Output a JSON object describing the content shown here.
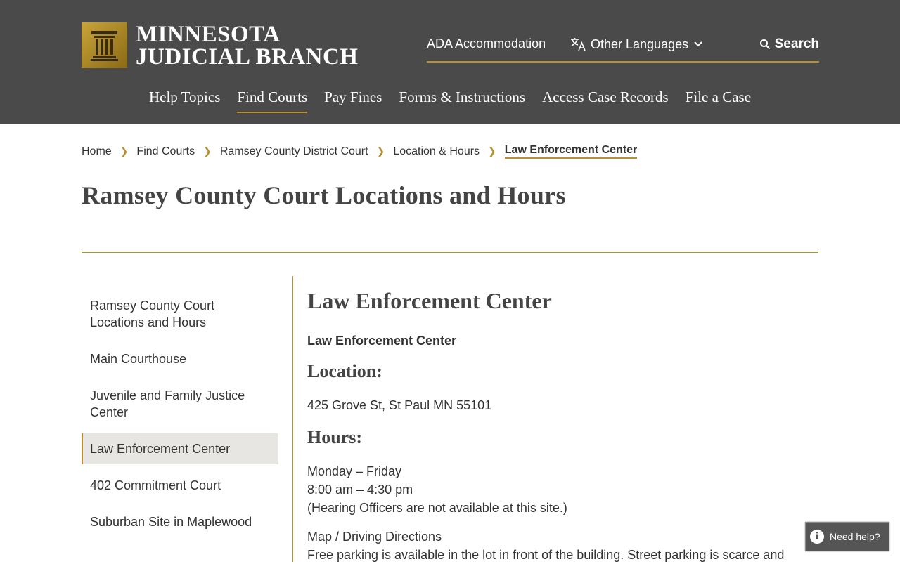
{
  "header": {
    "logo_line1": "MINNESOTA",
    "logo_line2": "JUDICIAL BRANCH",
    "utility": {
      "ada": "ADA Accommodation",
      "languages": "Other Languages",
      "search": "Search"
    },
    "nav": [
      "Help Topics",
      "Find Courts",
      "Pay Fines",
      "Forms & Instructions",
      "Access Case Records",
      "File a Case"
    ],
    "nav_active": "Find Courts"
  },
  "breadcrumb": [
    "Home",
    "Find Courts",
    "Ramsey County District Court",
    "Location & Hours",
    "Law Enforcement Center"
  ],
  "page_title": "Ramsey County Court Locations and Hours",
  "sidenav": [
    "Ramsey County Court Locations and Hours",
    "Main Courthouse",
    "Juvenile and Family Justice Center",
    "Law Enforcement Center",
    "402 Commitment Court",
    "Suburban Site in Maplewood"
  ],
  "content": {
    "heading": "Law Enforcement Center",
    "subheading": "Law Enforcement Center",
    "location_label": "Location:",
    "address": "425 Grove St, St Paul MN 55101",
    "hours_label": "Hours:",
    "hours_days": "Monday – Friday",
    "hours_time": "8:00 am – 4:30 pm",
    "hours_note": "(Hearing Officers are not available at this site.)",
    "map_link": "Map",
    "directions_link": "Driving Directions",
    "parking_text": "Free parking is available in the lot in front of the building. Street parking is scarce and"
  },
  "help_button": "Need help?",
  "colors": {
    "header_bg": "#4a4a4a",
    "accent_gold": "#b8912e",
    "active_bg": "#e8e6e3"
  }
}
